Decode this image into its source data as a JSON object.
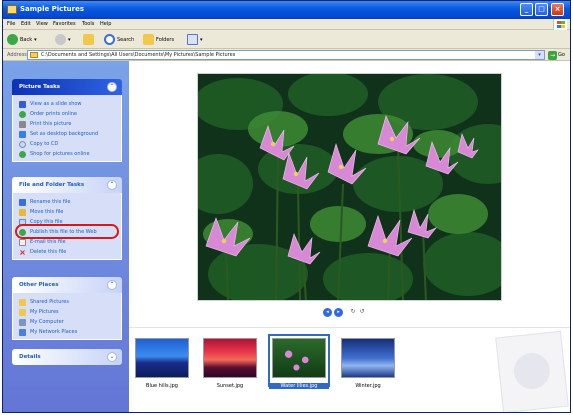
{
  "window": {
    "title": "Sample Pictures"
  },
  "menu": [
    "File",
    "Edit",
    "View",
    "Favorites",
    "Tools",
    "Help"
  ],
  "toolbar": {
    "back": "Back",
    "search": "Search",
    "folders": "Folders"
  },
  "address": {
    "label": "Address",
    "path": "C:\\Documents and Settings\\All Users\\Documents\\My Pictures\\Sample Pictures",
    "go": "Go"
  },
  "panels": {
    "picture_tasks": {
      "title": "Picture Tasks",
      "items": [
        {
          "label": "View as a slide show",
          "icon": "slideshow-icon"
        },
        {
          "label": "Order prints online",
          "icon": "order-prints-icon"
        },
        {
          "label": "Print this picture",
          "icon": "printer-icon"
        },
        {
          "label": "Set as desktop background",
          "icon": "desktop-icon"
        },
        {
          "label": "Copy to CD",
          "icon": "cd-icon"
        },
        {
          "label": "Shop for pictures online",
          "icon": "shop-icon"
        }
      ]
    },
    "file_folder_tasks": {
      "title": "File and Folder Tasks",
      "items": [
        {
          "label": "Rename this file",
          "icon": "rename-icon"
        },
        {
          "label": "Move this file",
          "icon": "move-icon"
        },
        {
          "label": "Copy this file",
          "icon": "copy-icon"
        },
        {
          "label": "Publish this file to the Web",
          "icon": "web-publish-icon"
        },
        {
          "label": "E-mail this file",
          "icon": "email-icon"
        },
        {
          "label": "Delete this file",
          "icon": "delete-icon"
        }
      ]
    },
    "other_places": {
      "title": "Other Places",
      "items": [
        {
          "label": "Shared Pictures",
          "icon": "folder-icon"
        },
        {
          "label": "My Pictures",
          "icon": "folder-icon"
        },
        {
          "label": "My Computer",
          "icon": "computer-icon"
        },
        {
          "label": "My Network Places",
          "icon": "network-icon"
        }
      ]
    },
    "details": {
      "title": "Details"
    }
  },
  "filmstrip": [
    {
      "label": "Blue hills.jpg",
      "selected": false
    },
    {
      "label": "Sunset.jpg",
      "selected": false
    },
    {
      "label": "Water lilies.jpg",
      "selected": true
    },
    {
      "label": "Winter.jpg",
      "selected": false
    }
  ],
  "colors": {
    "title_bar": "#0549d4",
    "task_pane": "#6375d6",
    "panel_body": "#d6dff7",
    "link": "#215dc6",
    "highlight_ring": "#d8181a",
    "selection": "#316ac5"
  }
}
